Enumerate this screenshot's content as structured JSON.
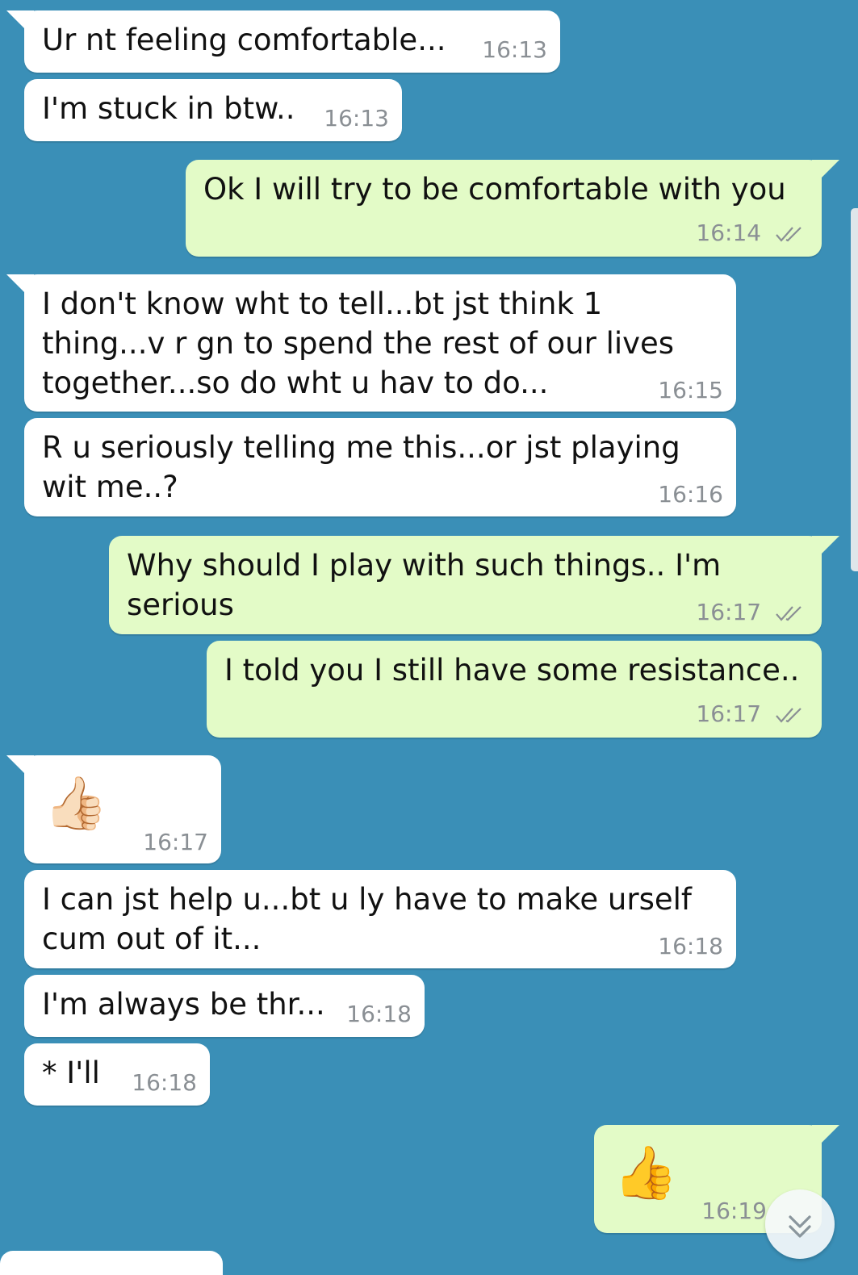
{
  "messages": [
    {
      "text": "Ur nt feeling comfortable...",
      "time": "16:13"
    },
    {
      "text": "I'm stuck in btw..",
      "time": "16:13"
    },
    {
      "text": "Ok I will try to be comfortable with you",
      "time": "16:14"
    },
    {
      "text": "I don't know wht to tell...bt jst think 1\nthing...v r gn to spend the rest of our lives\ntogether...so do wht u hav to do...",
      "time": "16:15"
    },
    {
      "text": "R u seriously telling me this...or jst playing\nwit me..?",
      "time": "16:16"
    },
    {
      "text": "Why should I play with such things.. I'm\nserious",
      "time": "16:17"
    },
    {
      "text": "I told you I still have some resistance..",
      "time": "16:17"
    },
    {
      "emoji": "👍🏻",
      "time": "16:17"
    },
    {
      "text": "I can jst help u...bt u ly have to make urself\ncum out of it...",
      "time": "16:18"
    },
    {
      "text": "I'm always be thr...",
      "time": "16:18"
    },
    {
      "text": "* I'll",
      "time": "16:18"
    },
    {
      "emoji": "👍",
      "time": "16:19"
    }
  ],
  "icons": {
    "read_ticks": "double-check-icon",
    "scroll_down": "chevron-double-down-icon"
  },
  "colors": {
    "background": "#3a8fb7",
    "incoming": "#ffffff",
    "outgoing": "#e3fbc7",
    "ticks": "#8a8f94"
  }
}
